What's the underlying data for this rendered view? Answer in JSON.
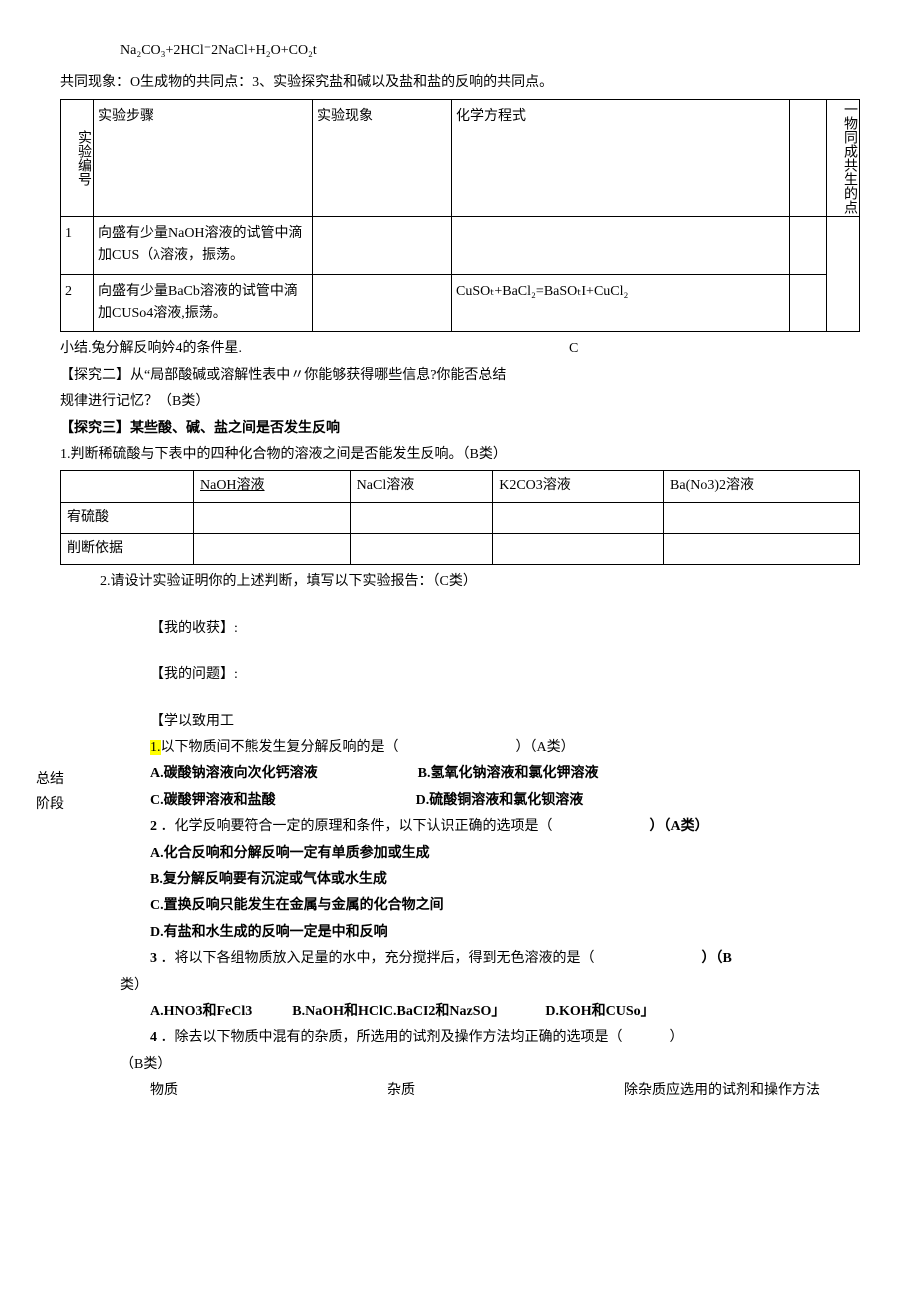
{
  "formula": "Na₂CO₃+2HCl⁻2NaCl+H₂O+CO₂t",
  "common_line": "共同现象：O生成物的共同点：3、实验探究盐和碱以及盐和盐的反响的共同点。",
  "table1": {
    "headers": [
      "实验编号",
      "实验步骤",
      "实验现象",
      "化学方程式",
      "",
      "一物同成共生的点"
    ],
    "rows": [
      {
        "no": "1",
        "step": "向盛有少量NaOH溶液的试管中滴加CUS（λ溶液，振荡。",
        "phen": "",
        "eq": ""
      },
      {
        "no": "2",
        "step": "向盛有少量BaCb溶液的试管中滴加CUSo4溶液,振荡。",
        "phen": "",
        "eq": "CuSOₜ+BaCl₂=BaSOₜI+CuCl₂"
      }
    ]
  },
  "summary_line": "小结.兔分解反响妗4的条件星.",
  "summary_c": "C",
  "inquiry2a": "【探究二】从“局部酸碱或溶解性表中〃你能够获得哪些信息?你能否总结",
  "inquiry2b": "规律进行记忆？（B类）",
  "inquiry3_title": "【探究三】某些酸、碱、盐之间是否发生反响",
  "inquiry3_1": "1.判断稀硫酸与下表中的四种化合物的溶液之间是否能发生反响。（B类）",
  "table2": {
    "headers": [
      "",
      "NaOH溶液",
      "NaCl溶液",
      "K2CO3溶液",
      "Ba(No3)2溶液"
    ],
    "r1": "宥硫酸",
    "r2": "削断依据"
  },
  "inquiry3_2": "2.请设计实验证明你的上述判断，填写以下实验报告：（C类）",
  "my_harvest": "【我的收获】:",
  "my_question": "【我的问题】:",
  "study_apply": "【学以致用工",
  "sidebar": "总结阶段",
  "q1": {
    "no": "1.",
    "text": "以下物质间不熊发生复分解反响的是（",
    "blank": "）（A类）",
    "A": "A.碳酸钠溶液向次化钙溶液",
    "B": "B.氢氧化钠溶液和氯化钾溶液",
    "C": "C.碳酸钾溶液和盐酸",
    "D": "D.硫酸铜溶液和氯化钡溶液"
  },
  "q2": {
    "no": "2",
    "text": "．化学反响要符合一定的原理和条件，以下认识正确的选项是（",
    "blank": "）（A类）",
    "A": "A.化合反响和分解反响一定有单质参加或生成",
    "B": "B.复分解反响要有沉淀或气体或水生成",
    "C": "C.置换反响只能发生在金属与金属的化合物之间",
    "D": "D.有盐和水生成的反响一定是中和反响"
  },
  "q3": {
    "no": "3",
    "text": "．将以下各组物质放入足量的水中，充分搅拌后，得到无色溶液的是（",
    "blank": "）（B",
    "tail": "类）",
    "A": "A.HNO3和FeCl3",
    "B": "B.NaOH和HClC.BaCI2和NazSO」",
    "D": "D.KOH和CUSo」"
  },
  "q4": {
    "no": "4",
    "text": "．除去以下物质中混有的杂质，所选用的试剂及操作方法均正确的选项是（",
    "blank": "）",
    "tail": "（B类）",
    "h1": "物质",
    "h2": "杂质",
    "h3": "除杂质应选用的试剂和操作方法"
  }
}
